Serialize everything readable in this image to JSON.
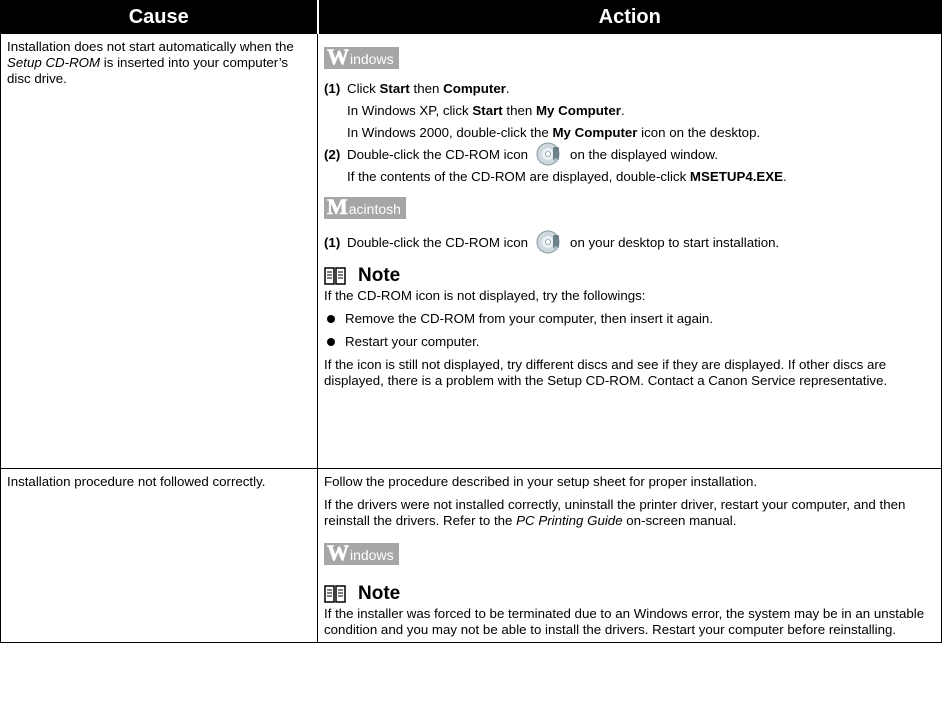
{
  "header": {
    "cause": "Cause",
    "action": "Action"
  },
  "row1": {
    "cause_pre": "Installation does not start automatically when the ",
    "cause_em": "Setup CD-ROM",
    "cause_post": " is inserted into your computer’s disc drive.",
    "windows_badge": {
      "initial": "W",
      "rest": "indows"
    },
    "step1": {
      "num": "(1)",
      "t1": "Click ",
      "b1": "Start",
      "t2": " then ",
      "b2": "Computer",
      "t3": "."
    },
    "step1_xp": {
      "t1": "In Windows XP, click ",
      "b1": "Start",
      "t2": " then ",
      "b2": "My Computer",
      "t3": "."
    },
    "step1_2000": {
      "t1": "In Windows 2000, double-click the ",
      "b1": "My Computer",
      "t2": " icon on the desktop."
    },
    "step2": {
      "num": "(2)",
      "t1": "Double-click the CD-ROM icon",
      "t2": "on the displayed window."
    },
    "step2_sub": {
      "t1": "If the contents of the CD-ROM are displayed, double-click ",
      "b1": "MSETUP4.EXE",
      "t2": "."
    },
    "mac_badge": {
      "initial": "M",
      "rest": "acintosh"
    },
    "mac_step": {
      "num": "(1)",
      "t1": "Double-click the CD-ROM icon",
      "t2": "on your desktop to start installation."
    },
    "note": {
      "title": "Note",
      "intro": "If the CD-ROM icon is not displayed, try the followings:",
      "bullets": [
        "Remove the CD-ROM from your computer, then insert it again.",
        "Restart your computer."
      ],
      "outro": "If the icon is still not displayed, try different discs and see if they are displayed. If other discs are displayed, there is a problem with the Setup CD-ROM. Contact a Canon Service representative."
    }
  },
  "row2": {
    "cause": "Installation procedure not followed correctly.",
    "p1": "Follow the procedure described in your setup sheet for proper installation.",
    "p2_pre": "If the drivers were not installed correctly, uninstall the printer driver, restart your computer, and then reinstall the drivers. Refer to the ",
    "p2_em": "PC Printing Guide",
    "p2_post": " on-screen manual.",
    "windows_badge": {
      "initial": "W",
      "rest": "indows"
    },
    "note": {
      "title": "Note",
      "text": "If the installer was forced to be terminated due to an Windows error, the system may be in an unstable condition and you may not be able to install the drivers. Restart your computer before reinstalling."
    }
  },
  "icons": [
    "cd-rom-icon",
    "note-book-icon"
  ]
}
